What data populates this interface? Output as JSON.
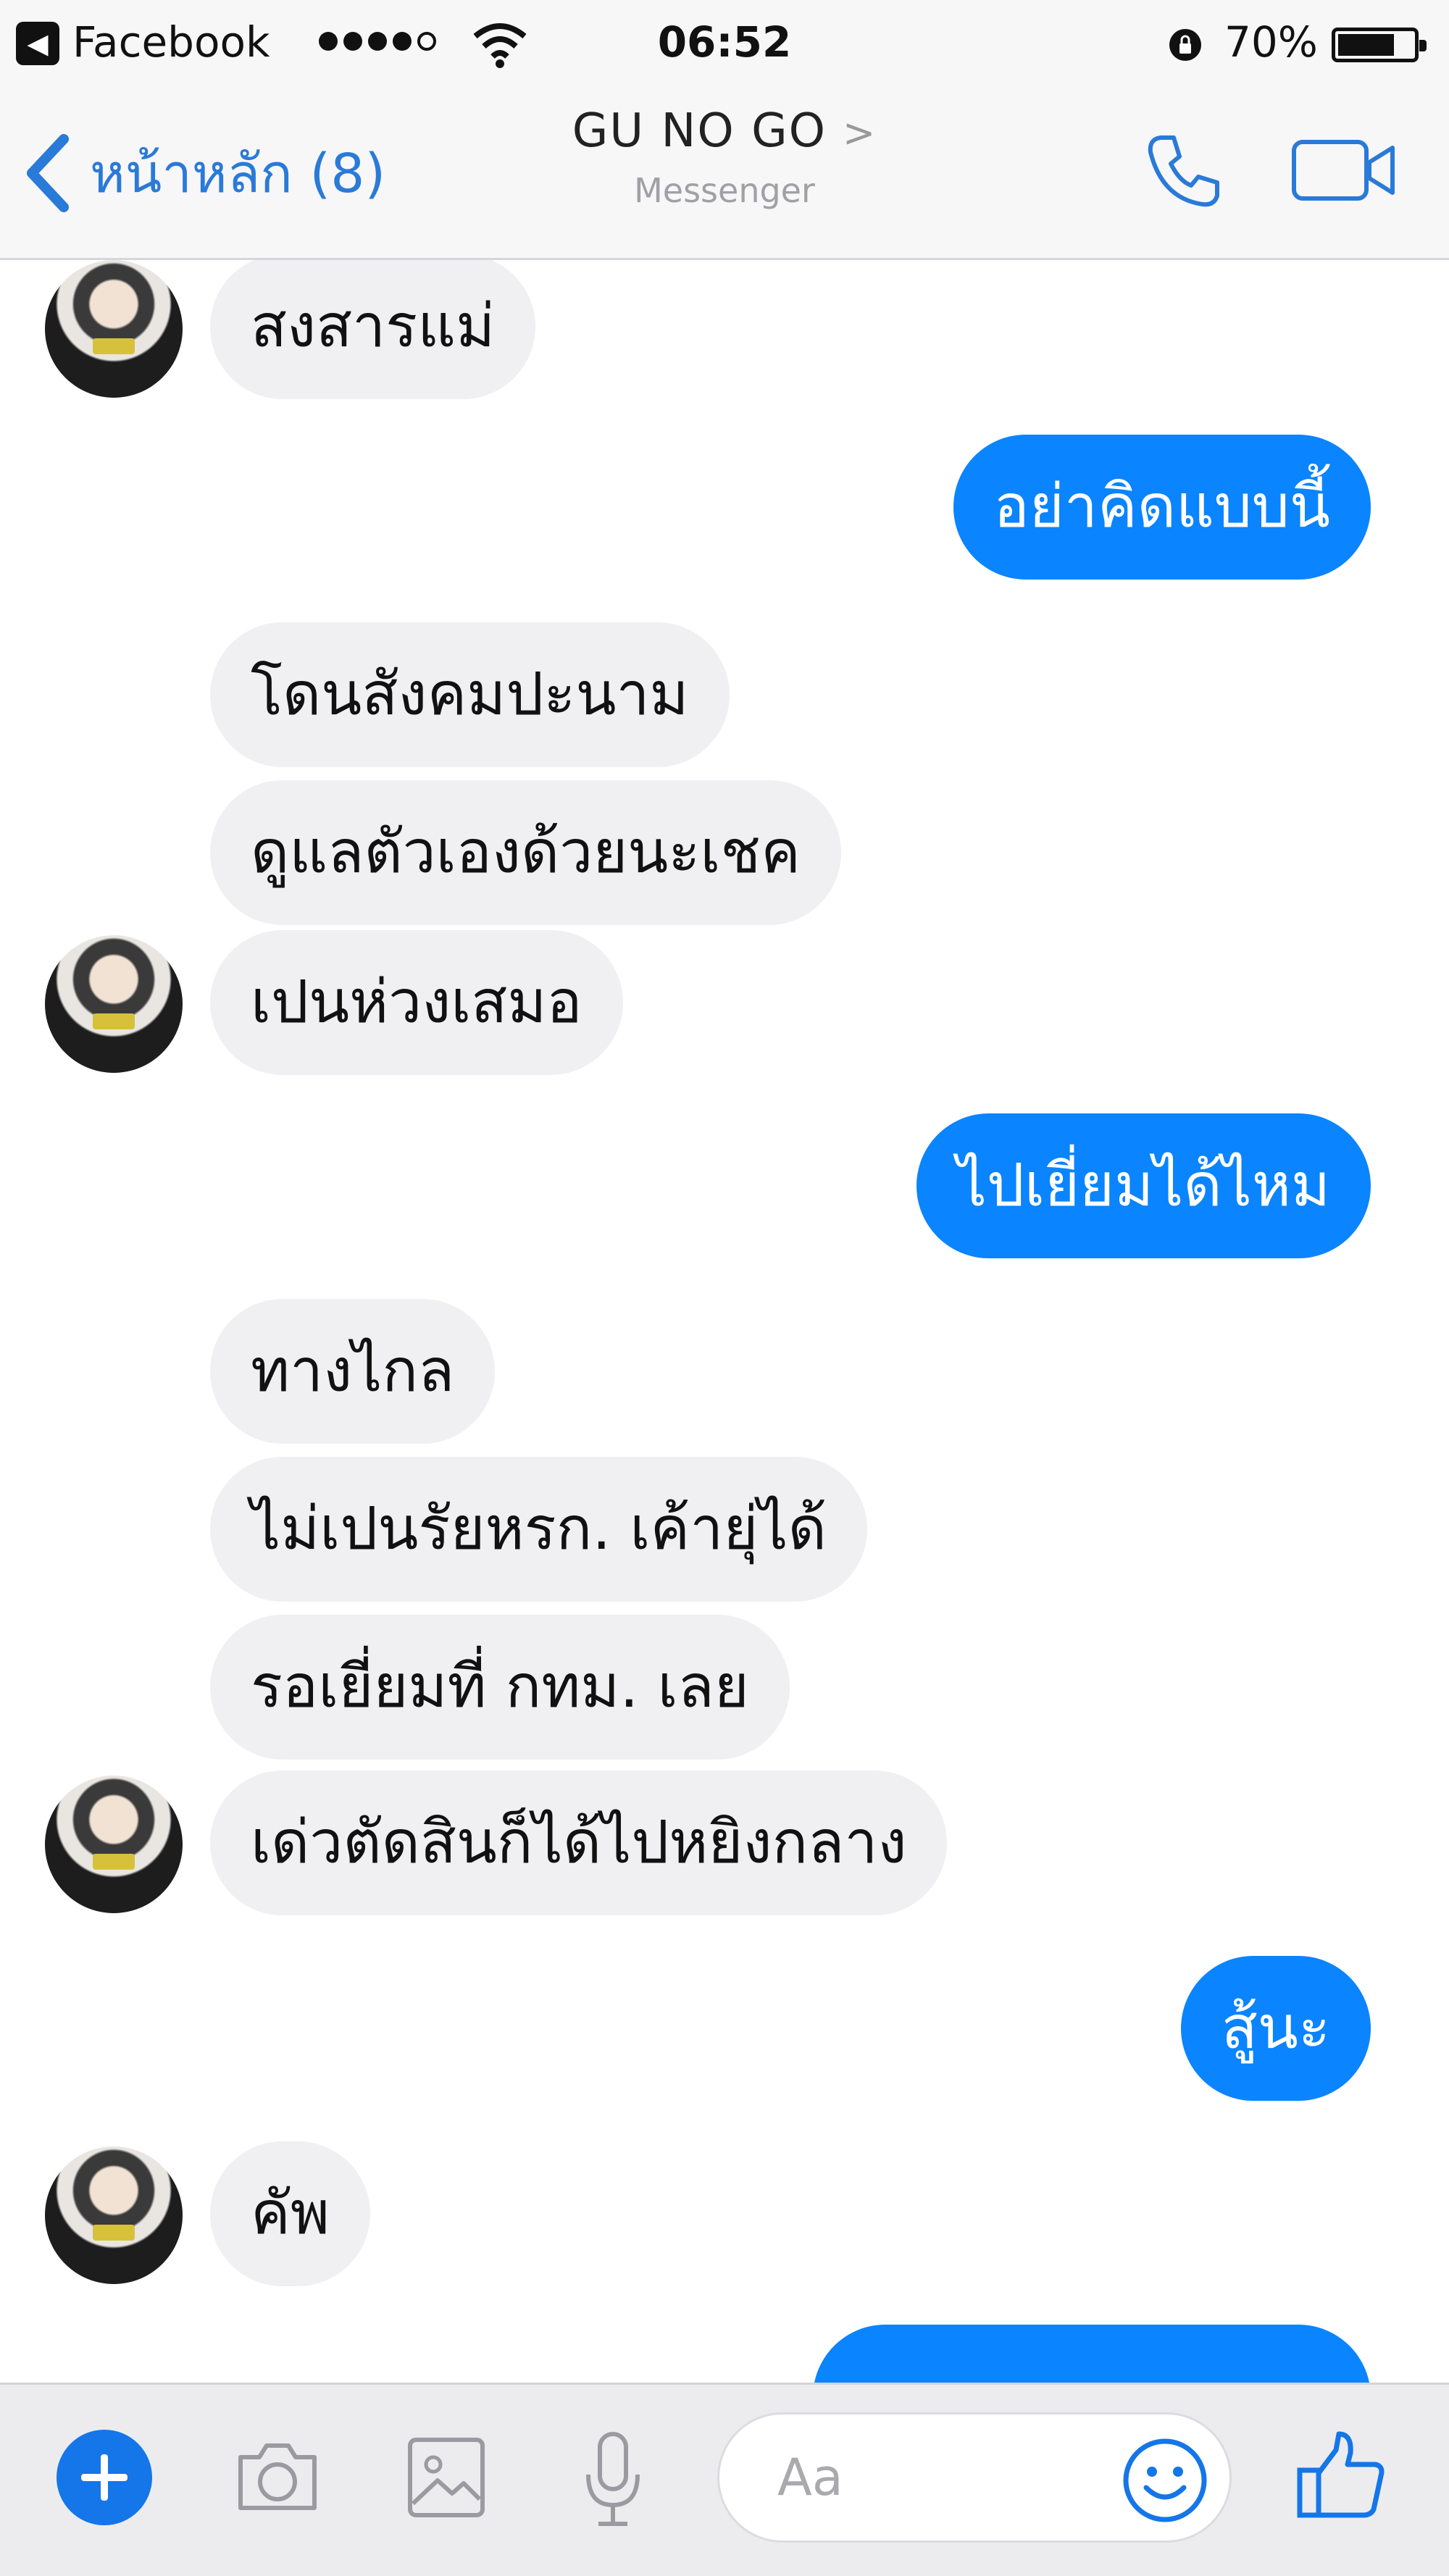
{
  "status_bar": {
    "back_app": "Facebook",
    "time": "06:52",
    "battery": "70%",
    "battery_level": 0.7
  },
  "nav": {
    "back_label": "หน้าหลัก (8)",
    "title": "GU NO GO",
    "subtitle": "Messenger"
  },
  "messages": [
    {
      "direction": "in",
      "text": "สงสารแม่"
    },
    {
      "direction": "out",
      "text": "อย่าคิดแบบนี้"
    },
    {
      "direction": "in",
      "text": "โดนสังคมปะนาม"
    },
    {
      "direction": "in",
      "text": "ดูแลตัวเองด้วยนะเชค"
    },
    {
      "direction": "in",
      "text": "เปนห่วงเสมอ"
    },
    {
      "direction": "out",
      "text": "ไปเยี่ยมได้ไหม"
    },
    {
      "direction": "in",
      "text": "ทางไกล"
    },
    {
      "direction": "in",
      "text": "ไม่เปนรัยหรก. เค้ายุ่ได้"
    },
    {
      "direction": "in",
      "text": "รอเยี่ยมที่  กทม. เลย"
    },
    {
      "direction": "in",
      "text": "เด่วตัดสินก็ได้ไปหยิงกลาง"
    },
    {
      "direction": "out",
      "text": "สู้นะ"
    },
    {
      "direction": "in",
      "text": "คัพ"
    }
  ],
  "composer": {
    "placeholder": "Aa"
  },
  "colors": {
    "accent": "#0a84ff",
    "incoming_bubble": "#f0f0f3",
    "link_blue": "#2a7ad8"
  }
}
